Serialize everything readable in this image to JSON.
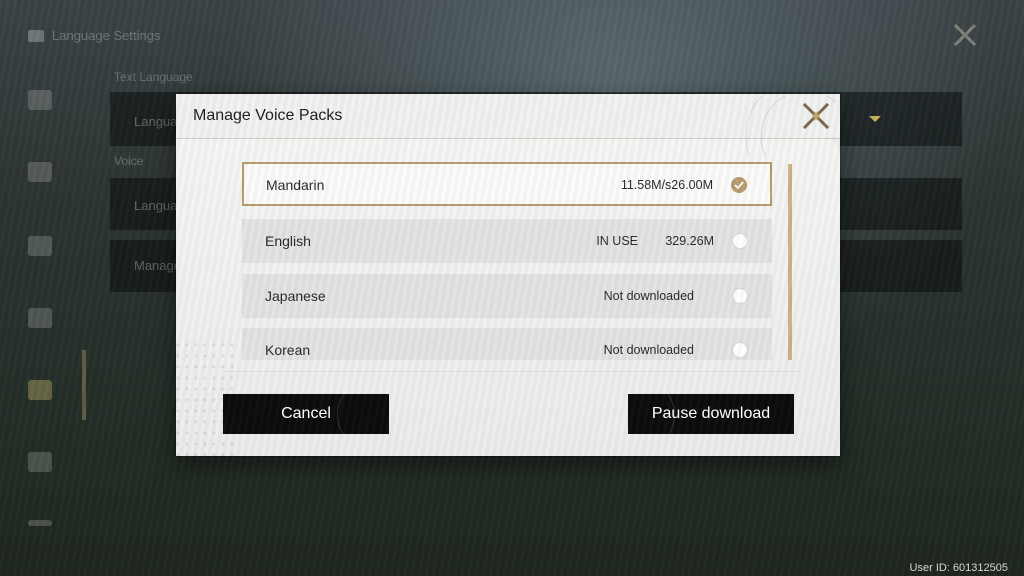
{
  "background": {
    "settings_title": "Language Settings",
    "labels": [
      "Text Language",
      "Language",
      "Voice",
      "Language",
      "Manage"
    ],
    "user_id": "User ID: 601312505"
  },
  "dialog": {
    "title": "Manage Voice Packs",
    "accent_color": "#b89c70",
    "voice_packs": [
      {
        "name": "Mandarin",
        "status": "",
        "size": "11.58M/s26.00M",
        "selected": true
      },
      {
        "name": "English",
        "status": "IN USE",
        "size": "329.26M",
        "selected": false
      },
      {
        "name": "Japanese",
        "status": "Not downloaded",
        "size": "",
        "selected": false
      },
      {
        "name": "Korean",
        "status": "Not downloaded",
        "size": "",
        "selected": false
      }
    ],
    "cancel_label": "Cancel",
    "pause_label": "Pause download"
  }
}
